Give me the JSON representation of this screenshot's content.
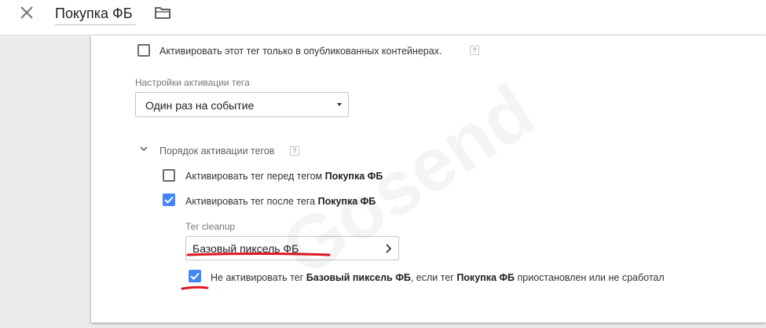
{
  "header": {
    "title": "Покупка ФБ",
    "close_icon": "close-icon",
    "folder_icon": "folder-icon"
  },
  "settings": {
    "published_only": {
      "label": "Активировать этот тег только в опубликованных контейнерах.",
      "checked": false,
      "help": "?"
    },
    "firing_options": {
      "label": "Настройки активации тега",
      "value": "Один раз на событие"
    },
    "sequencing": {
      "title": "Порядок активации тегов",
      "help": "?",
      "expanded": true,
      "before": {
        "prefix": "Активировать тег перед тегом ",
        "tag": "Покупка ФБ",
        "checked": false
      },
      "after": {
        "prefix": "Активировать тег после тега ",
        "tag": "Покупка ФБ",
        "checked": true
      },
      "cleanup_label": "Тег cleanup",
      "cleanup_value": "Базовый пиксель ФБ",
      "dont_fire": {
        "p1": "Не активировать тег ",
        "b1": "Базовый пиксель ФБ",
        "p2": ", если тег ",
        "b2": "Покупка ФБ",
        "p3": " приостановлен или не сработал",
        "checked": true
      }
    }
  },
  "watermark": "Gosend",
  "colors": {
    "accent": "#4285f4",
    "annotation": "#e0161f",
    "backdrop": "#ebebeb"
  }
}
